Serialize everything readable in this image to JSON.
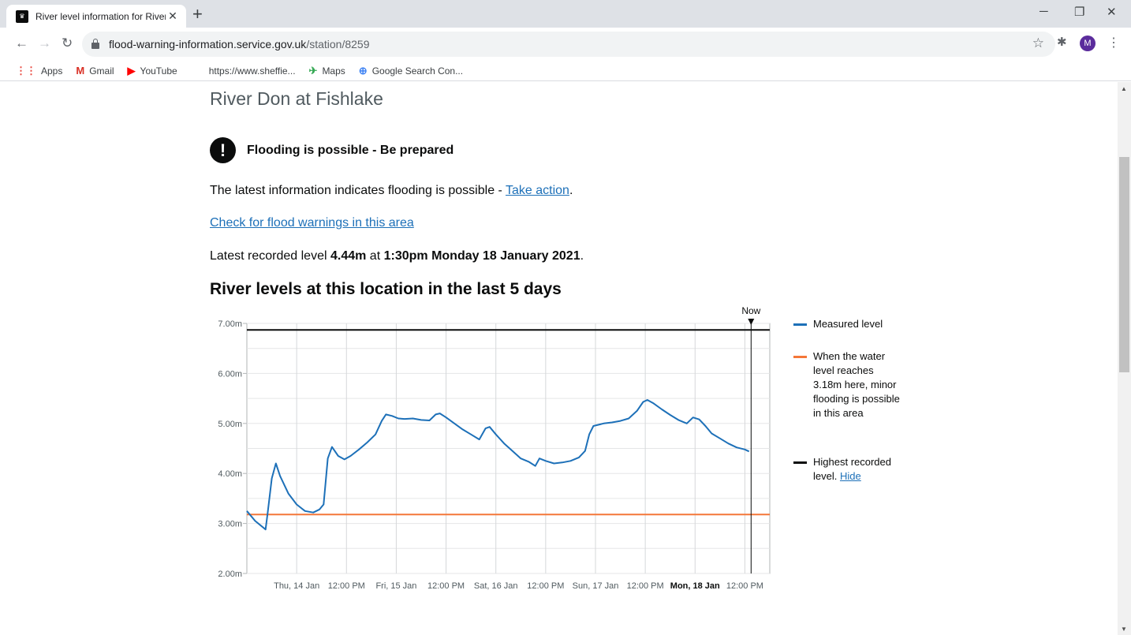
{
  "browser": {
    "tab_title": "River level information for River Don",
    "url_host": "flood-warning-information.service.gov.uk",
    "url_path": "/station/8259",
    "profile_initial": "M",
    "bookmarks": [
      {
        "label": "Apps",
        "icon": "apps-grid-icon",
        "color": "#e8453c"
      },
      {
        "label": "Gmail",
        "icon": "gmail-icon",
        "color": "#d93025"
      },
      {
        "label": "YouTube",
        "icon": "youtube-icon",
        "color": "#ff0000"
      },
      {
        "label": "https://www.sheffie...",
        "icon": "blank-page-icon",
        "color": "#5f6368"
      },
      {
        "label": "Maps",
        "icon": "maps-icon",
        "color": "#34a853"
      },
      {
        "label": "Google Search Con...",
        "icon": "search-console-icon",
        "color": "#4285f4"
      }
    ]
  },
  "page": {
    "title": "River Don at Fishlake",
    "alert": "Flooding is possible - Be prepared",
    "info_prefix": "The latest information indicates flooding is possible - ",
    "take_action": "Take action",
    "info_suffix": ".",
    "check_link": "Check for flood warnings in this area",
    "latest_prefix": "Latest recorded level ",
    "latest_level": "4.44m",
    "latest_at": " at ",
    "latest_time": "1:30pm Monday 18 January 2021",
    "latest_suffix": ".",
    "chart_heading": "River levels at this location in the last 5 days"
  },
  "legend": {
    "measured": "Measured level",
    "minor": "When the water level reaches 3.18m here, minor flooding is possible in this area",
    "highest_prefix": "Highest recorded level. ",
    "hide": "Hide"
  },
  "colors": {
    "measured": "#1d70b8",
    "threshold": "#f47738",
    "highest": "#0b0c0c",
    "link": "#1d70b8"
  },
  "chart_data": {
    "type": "line",
    "ylim": [
      2.0,
      7.0
    ],
    "y_ticks": [
      "2.00m",
      "3.00m",
      "4.00m",
      "5.00m",
      "6.00m",
      "7.00m"
    ],
    "x_range_hours": [
      0,
      108
    ],
    "x_ticks": [
      {
        "label": "Thu, 14 Jan",
        "hour": 12,
        "bold": false
      },
      {
        "label": "12:00 PM",
        "hour": 24,
        "bold": false
      },
      {
        "label": "Fri, 15 Jan",
        "hour": 36,
        "bold": false
      },
      {
        "label": "12:00 PM",
        "hour": 48,
        "bold": false
      },
      {
        "label": "Sat, 16 Jan",
        "hour": 60,
        "bold": false
      },
      {
        "label": "12:00 PM",
        "hour": 72,
        "bold": false
      },
      {
        "label": "Sun, 17 Jan",
        "hour": 84,
        "bold": false
      },
      {
        "label": "12:00 PM",
        "hour": 96,
        "bold": false
      },
      {
        "label": "Mon, 18 Jan",
        "hour": 108,
        "bold": true
      },
      {
        "label": "12:00 PM",
        "hour": 120,
        "bold": false
      }
    ],
    "now_label": "Now",
    "now_hour": 121.5,
    "highest_level": 6.87,
    "threshold_level": 3.18,
    "series": [
      {
        "name": "Measured level",
        "points": [
          [
            0,
            3.25
          ],
          [
            2,
            3.05
          ],
          [
            4.5,
            2.88
          ],
          [
            5,
            3.2
          ],
          [
            6,
            3.9
          ],
          [
            7,
            4.2
          ],
          [
            8,
            3.95
          ],
          [
            10,
            3.6
          ],
          [
            12,
            3.38
          ],
          [
            14,
            3.25
          ],
          [
            16,
            3.22
          ],
          [
            17.5,
            3.28
          ],
          [
            18.5,
            3.38
          ],
          [
            19.5,
            4.3
          ],
          [
            20.5,
            4.53
          ],
          [
            22,
            4.35
          ],
          [
            23.5,
            4.28
          ],
          [
            25,
            4.35
          ],
          [
            27,
            4.48
          ],
          [
            29,
            4.62
          ],
          [
            31,
            4.78
          ],
          [
            32.5,
            5.05
          ],
          [
            33.5,
            5.18
          ],
          [
            35,
            5.15
          ],
          [
            36.5,
            5.1
          ],
          [
            38,
            5.09
          ],
          [
            40,
            5.1
          ],
          [
            42,
            5.07
          ],
          [
            44,
            5.06
          ],
          [
            45.5,
            5.18
          ],
          [
            46.5,
            5.2
          ],
          [
            48,
            5.12
          ],
          [
            50,
            5.0
          ],
          [
            52,
            4.88
          ],
          [
            54,
            4.78
          ],
          [
            56,
            4.68
          ],
          [
            57.5,
            4.9
          ],
          [
            58.5,
            4.93
          ],
          [
            60,
            4.78
          ],
          [
            62,
            4.6
          ],
          [
            64,
            4.45
          ],
          [
            66,
            4.3
          ],
          [
            68,
            4.23
          ],
          [
            69.5,
            4.15
          ],
          [
            70.5,
            4.3
          ],
          [
            72,
            4.25
          ],
          [
            74,
            4.2
          ],
          [
            76,
            4.22
          ],
          [
            78,
            4.25
          ],
          [
            80,
            4.32
          ],
          [
            81.5,
            4.45
          ],
          [
            82.5,
            4.78
          ],
          [
            83.5,
            4.95
          ],
          [
            86,
            5.0
          ],
          [
            88,
            5.02
          ],
          [
            90,
            5.05
          ],
          [
            92,
            5.1
          ],
          [
            94,
            5.25
          ],
          [
            95.5,
            5.43
          ],
          [
            96.5,
            5.47
          ],
          [
            98,
            5.4
          ],
          [
            100,
            5.28
          ],
          [
            102,
            5.17
          ],
          [
            104,
            5.07
          ],
          [
            106,
            5.0
          ],
          [
            107.5,
            5.12
          ],
          [
            109,
            5.08
          ],
          [
            110.5,
            4.95
          ],
          [
            112,
            4.8
          ],
          [
            114,
            4.7
          ],
          [
            116,
            4.6
          ],
          [
            118,
            4.52
          ],
          [
            120,
            4.48
          ],
          [
            121,
            4.44
          ]
        ]
      }
    ]
  }
}
